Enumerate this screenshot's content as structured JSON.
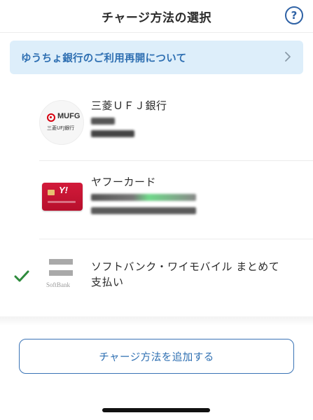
{
  "header": {
    "title": "チャージ方法の選択",
    "help_label": "?"
  },
  "notice": {
    "text": "ゆうちょ銀行のご利用再開について"
  },
  "payment_methods": [
    {
      "name": "三菱ＵＦＪ銀行",
      "logo_text": "MUFG",
      "logo_subtext": "三菱UFJ銀行",
      "selected": false
    },
    {
      "name": "ヤフーカード",
      "logo_text": "Y!",
      "selected": false
    },
    {
      "name": "ソフトバンク・ワイモバイル まとめて支払い",
      "logo_text": "SoftBank",
      "selected": true
    }
  ],
  "actions": {
    "add_method_label": "チャージ方法を追加する"
  },
  "colors": {
    "accent": "#2e6fb2",
    "notice_bg": "#ddeefa",
    "check": "#2e8b3c",
    "mufg_red": "#d7000f",
    "yahoo_red": "#c8153a"
  }
}
